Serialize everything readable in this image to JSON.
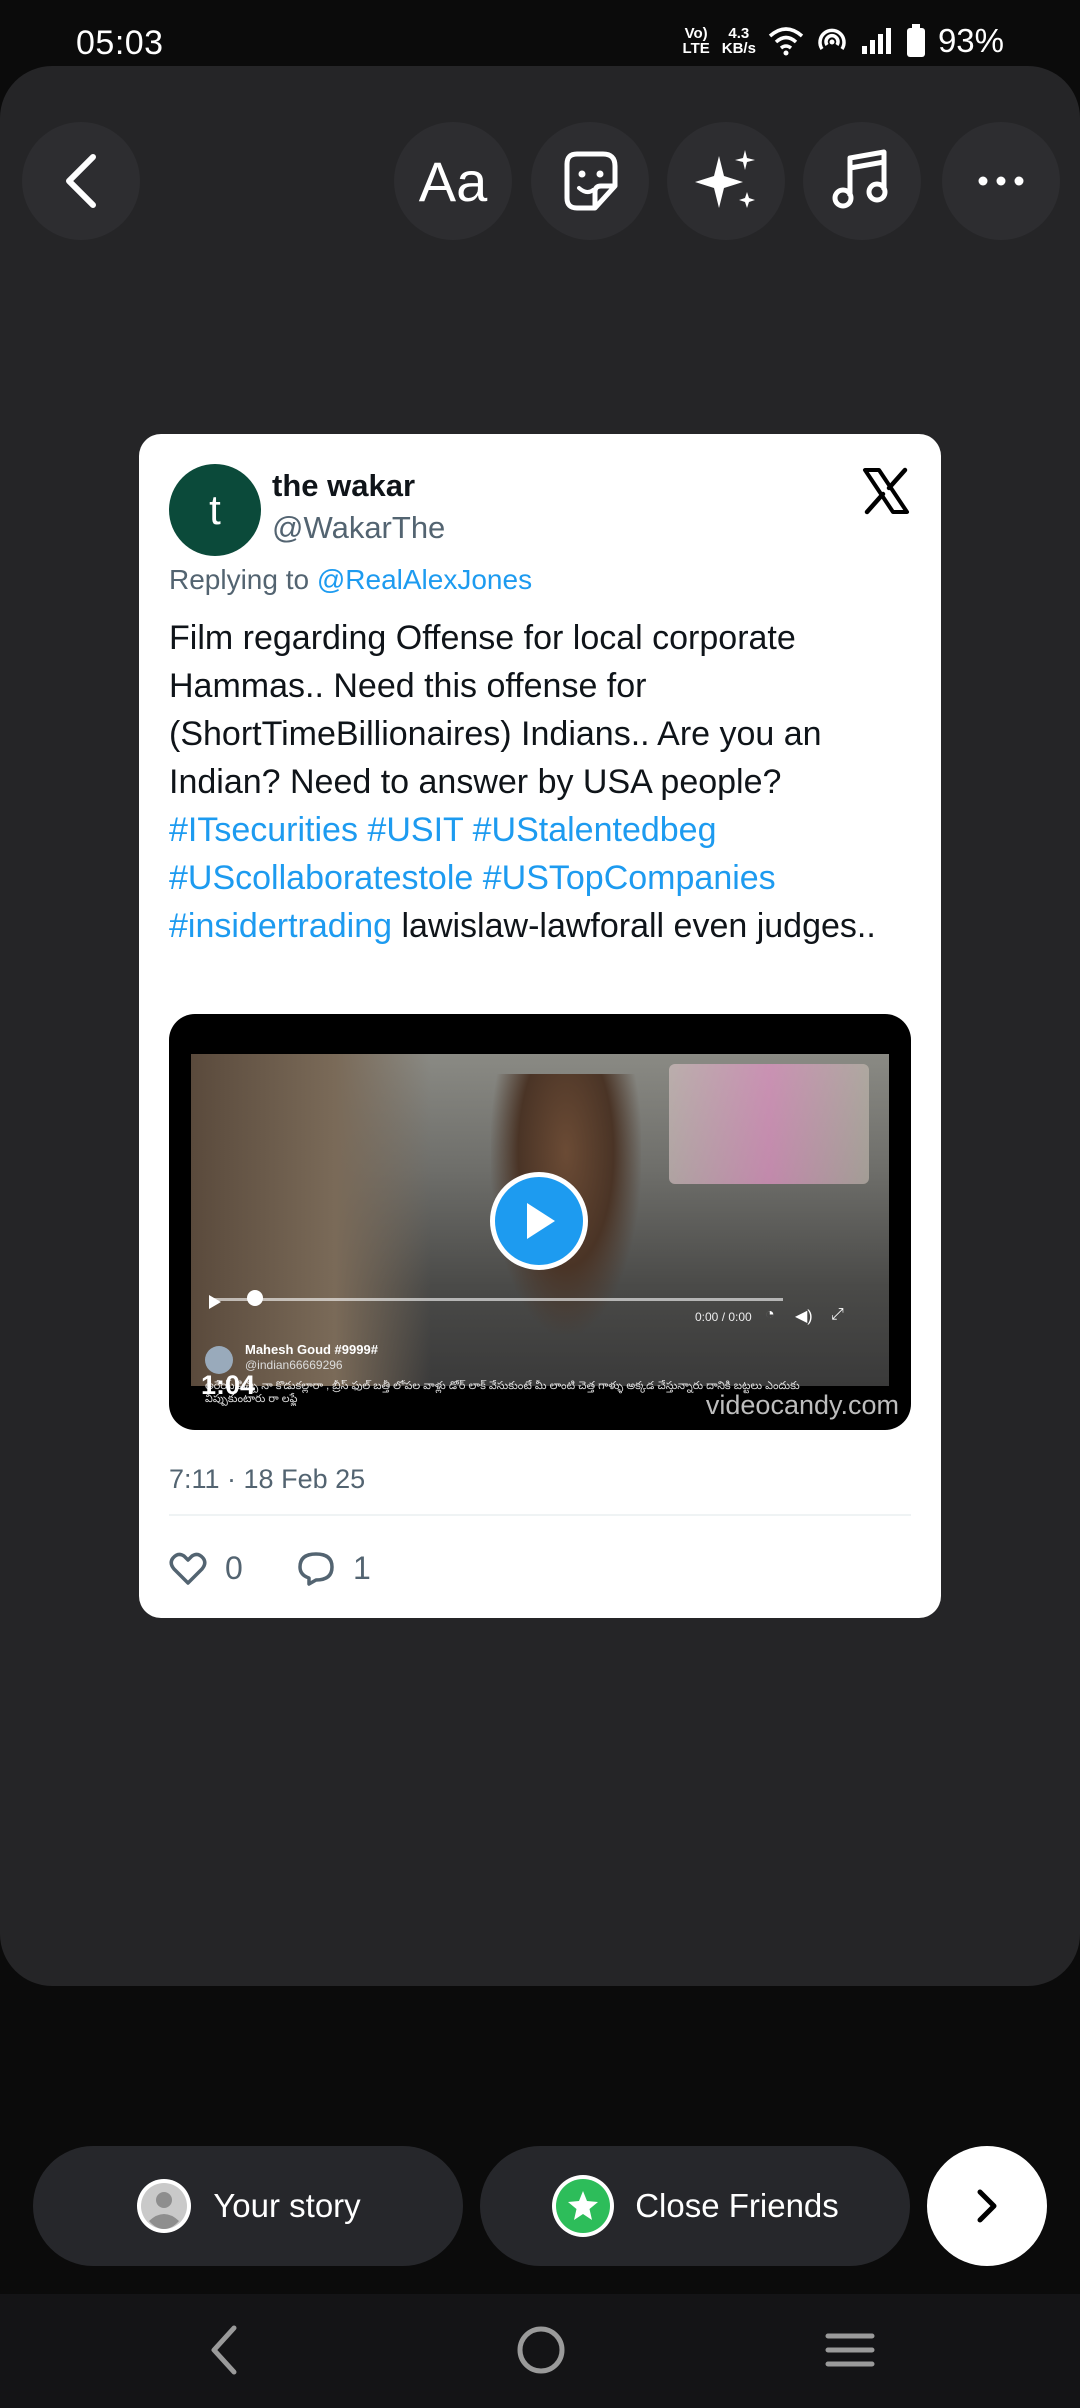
{
  "status_bar": {
    "time": "05:03",
    "network_top": "Vo)",
    "network_bottom": "LTE",
    "speed_top": "4.3",
    "speed_bottom": "KB/s",
    "battery_pct": "93%",
    "icons": [
      "wifi-icon",
      "hotspot-icon",
      "signal-icon",
      "battery-icon"
    ]
  },
  "toolbar": {
    "back": "back-arrow-icon",
    "text_tool_label": "Aa",
    "tools": [
      "sticker-icon",
      "effects-sparkle-icon",
      "music-note-icon",
      "more-dots-icon"
    ]
  },
  "tweet": {
    "avatar_letter": "t",
    "display_name": "the wakar",
    "handle": "@WakarThe",
    "replying_prefix": "Replying to ",
    "replying_handle": "@RealAlexJones",
    "text_1": "Film regarding Offense for local corporate Hammas.. Need this offense for (ShortTimeBillionaires) Indians.. Are you an Indian? Need to answer by USA people? ",
    "hashtags": [
      "#ITsecurities",
      "#USIT",
      "#UStalentedbeg",
      "#UScollaboratestole",
      "#USTopCompanies",
      "#insidertrading"
    ],
    "text_2": " lawislaw-lawforall even judges..",
    "video": {
      "duration": "1:04",
      "watermark": "videocandy.com",
      "player_time": "0:00 / 0:00",
      "embedded_user": "Mahesh Goud #9999#",
      "embedded_handle": "@indian66669296",
      "embedded_caption": "అరేయ్ పిచ్చి నా కొడుకల్లారా , బ్రీస్ ఫుల్ బత్తీ లోపల వాళ్లు డోర్ లాక్ వేసుకుంటే మీ లాంటి చెత్త గాళ్ళు అక్కడ చేస్తున్నారు దానికి బట్టలు ఎందుకు విప్పుకుంటారు రా లఫ్జే"
    },
    "timestamp": "7:11 · 18 Feb 25",
    "likes": "0",
    "replies": "1"
  },
  "share": {
    "your_story_label": "Your story",
    "close_friends_label": "Close Friends"
  },
  "colors": {
    "canvas": "#252527",
    "link_blue": "#1d9bf0",
    "close_friends_green": "#2dbd5a",
    "avatar_green": "#0b4a3a"
  }
}
